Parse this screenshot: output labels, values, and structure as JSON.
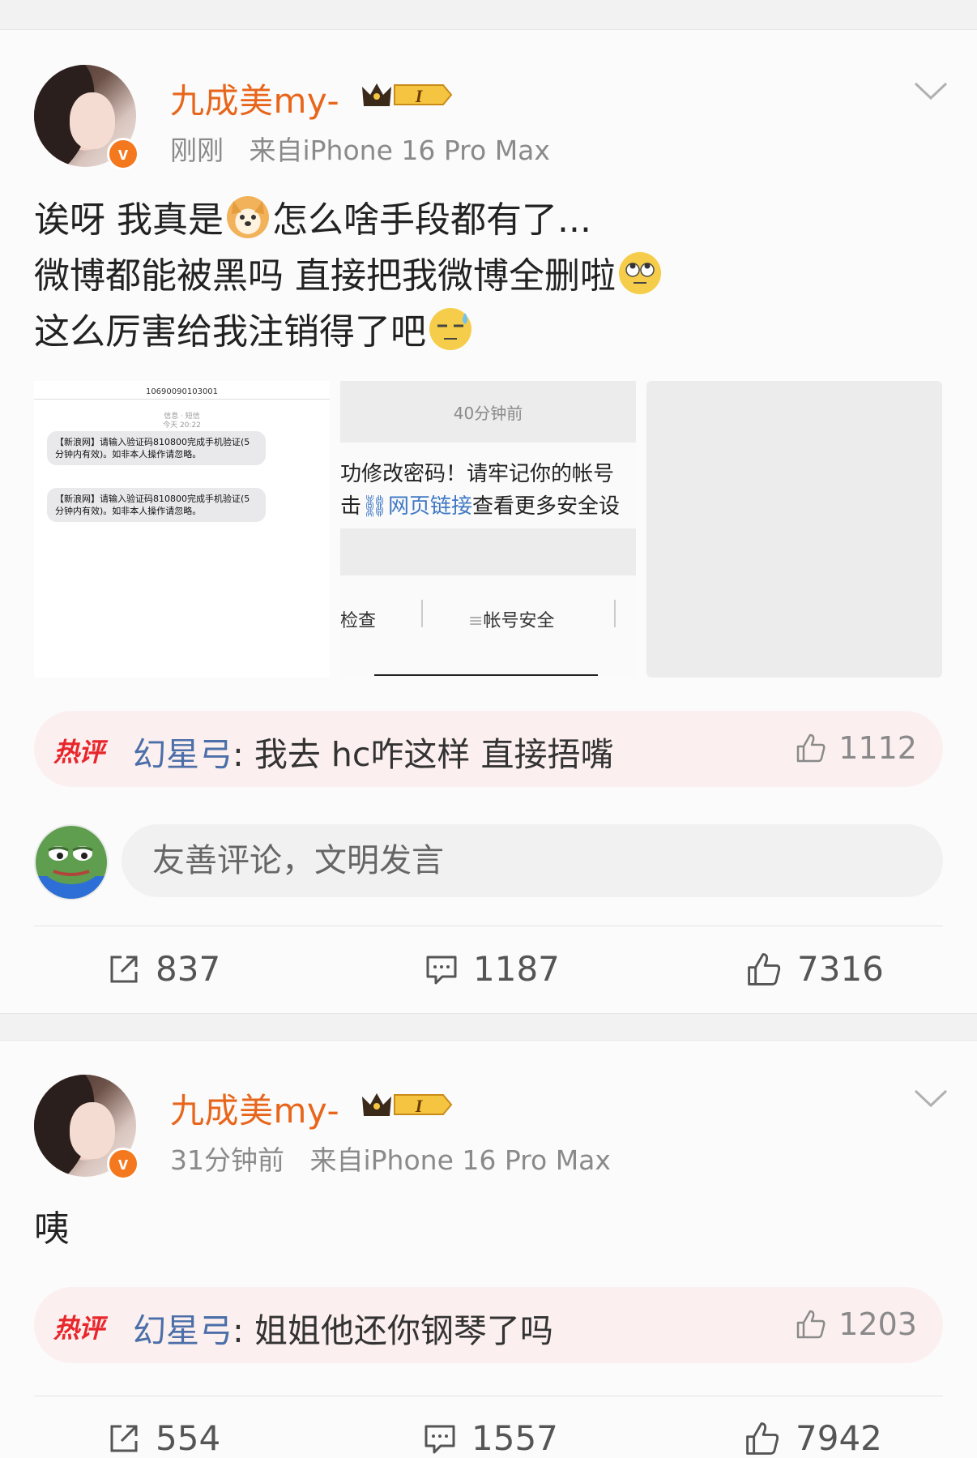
{
  "posts": [
    {
      "username": "九成美my-",
      "vip_level": "I",
      "time": "刚刚",
      "source": "来自iPhone 16 Pro Max",
      "lines": [
        {
          "before": "诶呀 我真是",
          "emoji": "dog-emoji",
          "after": "怎么啥手段都有了..."
        },
        {
          "before": "微博都能被黑吗 直接把我微博全删啦",
          "emoji": "eye-roll-emoji",
          "after": ""
        },
        {
          "before": "这么厉害给我注销得了吧",
          "emoji": "sweat-emoji",
          "after": ""
        }
      ],
      "images": {
        "sms": {
          "number": "10690090103001",
          "header1": "信息 · 短信",
          "header2": "今天 20:22",
          "msg1": "【新浪网】请输入验证码810800完成手机验证(5分钟内有效)。如非本人操作请忽略。",
          "msg2": "【新浪网】请输入验证码810800完成手机验证(5分钟内有效)。如非本人操作请忽略。"
        },
        "notice": {
          "time": "40分钟前",
          "line1": "功修改密码！请牢记你的帐号",
          "line2_prefix": "击",
          "line2_link": "网页链接",
          "line2_suffix": "查看更多安全设",
          "tab1": "检查",
          "tab2": "帐号安全"
        }
      },
      "hot_comment": {
        "tag": "热评",
        "user": "幻星弓",
        "text": ": 我去 hc咋这样 直接捂嘴",
        "likes": "1112"
      },
      "comment_placeholder": "友善评论，文明发言",
      "actions": {
        "share": "837",
        "comment": "1187",
        "like": "7316"
      }
    },
    {
      "username": "九成美my-",
      "vip_level": "I",
      "time": "31分钟前",
      "source": "来自iPhone 16 Pro Max",
      "text": "咦",
      "hot_comment": {
        "tag": "热评",
        "user": "幻星弓",
        "text": ": 姐姐他还你钢琴了吗",
        "likes": "1203"
      },
      "actions": {
        "share": "554",
        "comment": "1557",
        "like": "7942"
      }
    }
  ],
  "colors": {
    "username": "#e8661c",
    "hot_tag": "#e8262b",
    "hot_user": "#4b6fa8",
    "verified": "#f4781e"
  }
}
